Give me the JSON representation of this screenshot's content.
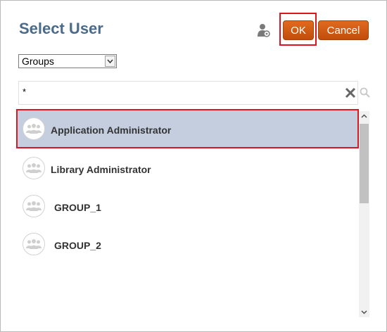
{
  "dialog": {
    "title": "Select User",
    "ok_label": "OK",
    "cancel_label": "Cancel",
    "accent_color": "#c9520b",
    "highlight_color": "#e0141e"
  },
  "filter": {
    "type_selected": "Groups",
    "search_value": "*"
  },
  "results": [
    {
      "label": "Application Administrator",
      "selected": true
    },
    {
      "label": "Library Administrator",
      "selected": false
    },
    {
      "label": "GROUP_1",
      "selected": false
    },
    {
      "label": "GROUP_2",
      "selected": false
    }
  ],
  "icons": {
    "header": "user-settings-icon",
    "clear": "close-icon",
    "search": "search-icon",
    "row": "group-icon"
  }
}
